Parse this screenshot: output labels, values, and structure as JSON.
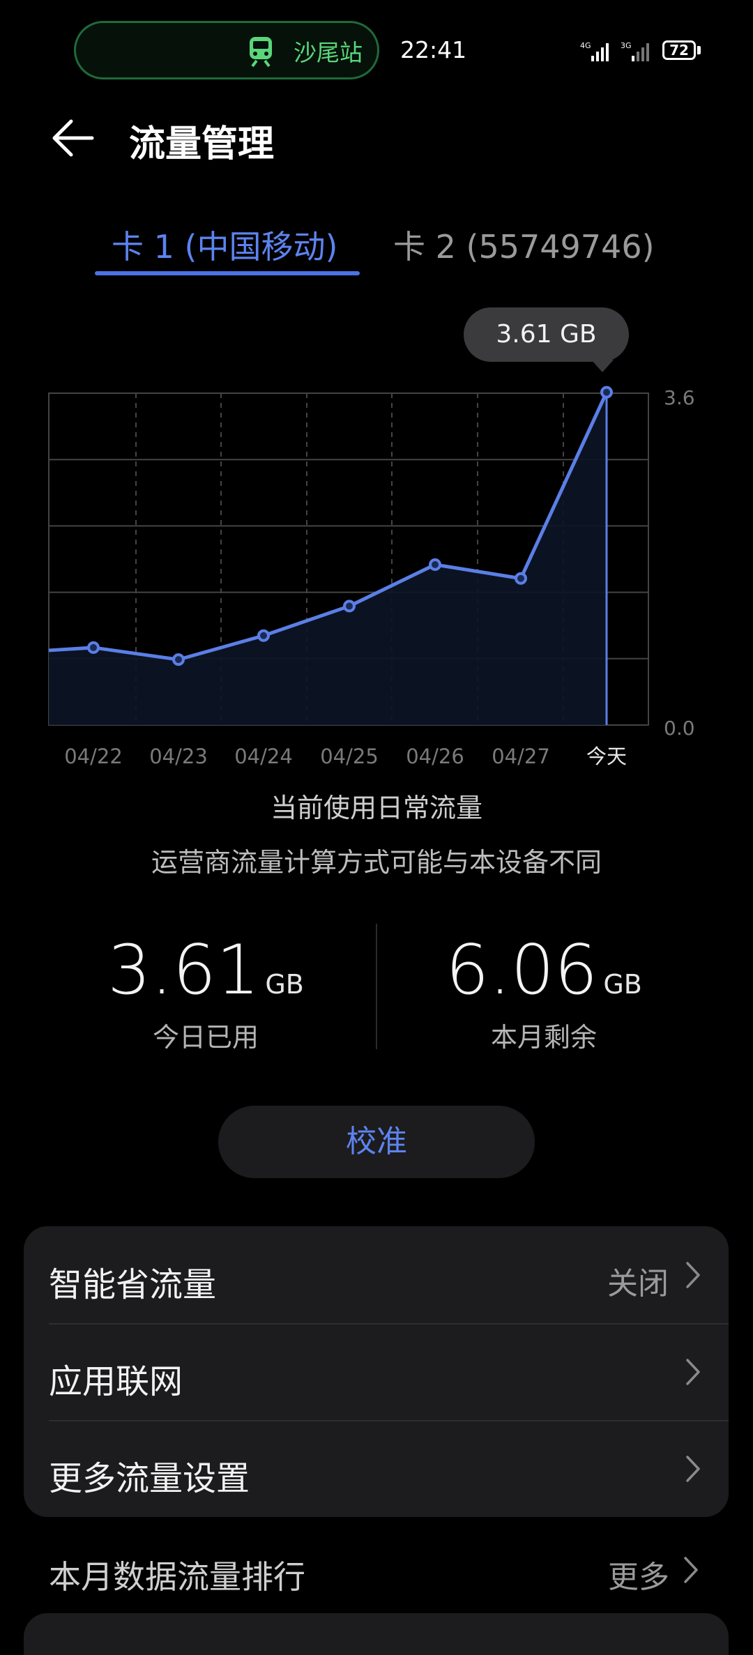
{
  "status_bar": {
    "station": "沙尾站",
    "time": "22:41",
    "signal1_label": "4G",
    "signal2_label": "3G",
    "battery": "72"
  },
  "header": {
    "title": "流量管理"
  },
  "tabs": [
    {
      "label": "卡 1 (中国移动)",
      "active": true
    },
    {
      "label": "卡 2 (55749746)",
      "active": false
    }
  ],
  "tooltip": "3.61 GB",
  "chart_data": {
    "type": "line",
    "categories": [
      "04/22",
      "04/23",
      "04/24",
      "04/25",
      "04/26",
      "04/27",
      "今天"
    ],
    "values": [
      0.84,
      0.71,
      0.97,
      1.29,
      1.74,
      1.59,
      3.61
    ],
    "y_tick_labels": [
      "3.6",
      "0.0"
    ],
    "ylim": [
      0,
      3.6
    ],
    "grid": true,
    "highlight_label": "3.61 GB",
    "colors": {
      "line": "#5b7fe6",
      "grid": "#444444"
    }
  },
  "chart_caption": "当前使用日常流量",
  "notice": "运营商流量计算方式可能与本设备不同",
  "stats": {
    "today": {
      "value": "3.61",
      "unit": "GB",
      "label": "今日已用"
    },
    "remaining": {
      "value": "6.06",
      "unit": "GB",
      "label": "本月剩余"
    }
  },
  "calibrate_label": "校准",
  "settings": [
    {
      "label": "智能省流量",
      "value": "关闭"
    },
    {
      "label": "应用联网",
      "value": ""
    },
    {
      "label": "更多流量设置",
      "value": ""
    }
  ],
  "ranking": {
    "title": "本月数据流量排行",
    "more": "更多"
  },
  "accent_color": "#5d83ef"
}
